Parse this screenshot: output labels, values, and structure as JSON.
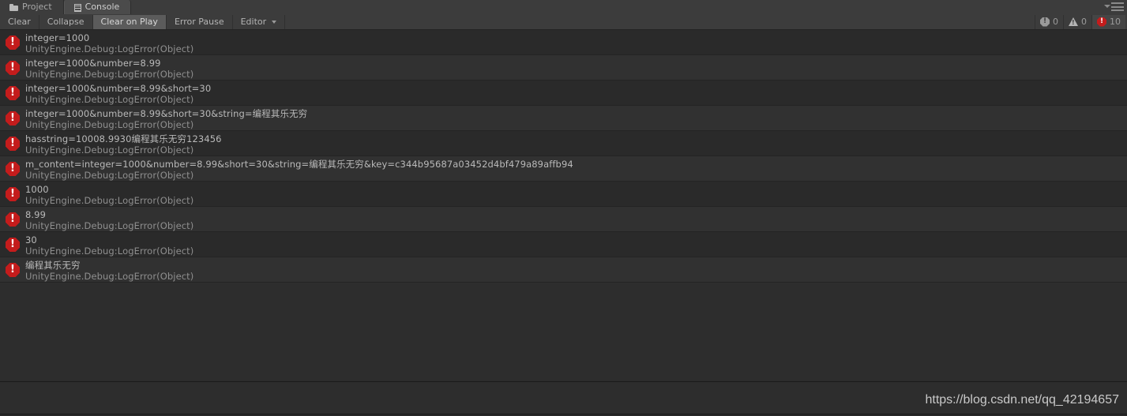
{
  "window": {
    "tabs": [
      {
        "label": "Project",
        "icon": "folder-icon",
        "active": false
      },
      {
        "label": "Console",
        "icon": "console-icon",
        "active": true
      }
    ],
    "menu_icon": "hamburger-menu-icon"
  },
  "toolbar": {
    "buttons": [
      {
        "label": "Clear",
        "active": false,
        "has_dropdown": false
      },
      {
        "label": "Collapse",
        "active": false,
        "has_dropdown": false
      },
      {
        "label": "Clear on Play",
        "active": true,
        "has_dropdown": false
      },
      {
        "label": "Error Pause",
        "active": false,
        "has_dropdown": false
      },
      {
        "label": "Editor",
        "active": false,
        "has_dropdown": true
      }
    ],
    "counters": [
      {
        "name": "info-count",
        "icon": "info-octagon-icon",
        "value": "0",
        "highlighted": false
      },
      {
        "name": "warning-count",
        "icon": "warning-triangle-icon",
        "value": "0",
        "highlighted": false
      },
      {
        "name": "error-count",
        "icon": "error-octagon-icon",
        "value": "10",
        "highlighted": true
      }
    ]
  },
  "console": {
    "entries": [
      {
        "icon": "error-icon",
        "message": "integer=1000",
        "stack": "UnityEngine.Debug:LogError(Object)"
      },
      {
        "icon": "error-icon",
        "message": "integer=1000&number=8.99",
        "stack": "UnityEngine.Debug:LogError(Object)"
      },
      {
        "icon": "error-icon",
        "message": "integer=1000&number=8.99&short=30",
        "stack": "UnityEngine.Debug:LogError(Object)"
      },
      {
        "icon": "error-icon",
        "message": "integer=1000&number=8.99&short=30&string=编程其乐无穷",
        "stack": "UnityEngine.Debug:LogError(Object)"
      },
      {
        "icon": "error-icon",
        "message": "hasstring=10008.9930编程其乐无穷123456",
        "stack": "UnityEngine.Debug:LogError(Object)"
      },
      {
        "icon": "error-icon",
        "message": "m_content=integer=1000&number=8.99&short=30&string=编程其乐无穷&key=c344b95687a03452d4bf479a89affb94",
        "stack": "UnityEngine.Debug:LogError(Object)"
      },
      {
        "icon": "error-icon",
        "message": "1000",
        "stack": "UnityEngine.Debug:LogError(Object)"
      },
      {
        "icon": "error-icon",
        "message": "8.99",
        "stack": "UnityEngine.Debug:LogError(Object)"
      },
      {
        "icon": "error-icon",
        "message": "30",
        "stack": "UnityEngine.Debug:LogError(Object)"
      },
      {
        "icon": "error-icon",
        "message": "编程其乐无穷",
        "stack": "UnityEngine.Debug:LogError(Object)"
      }
    ]
  },
  "watermark": {
    "text": "https://blog.csdn.net/qq_42194657"
  },
  "colors": {
    "error_red": "#c41c1c",
    "panel_bg": "#2d2d2d",
    "toolbar_bg": "#3c3c3c",
    "row_odd": "#2a2a2a",
    "row_even": "#313131",
    "text_primary": "#b9b9b9",
    "text_secondary": "#8f8f8f"
  }
}
